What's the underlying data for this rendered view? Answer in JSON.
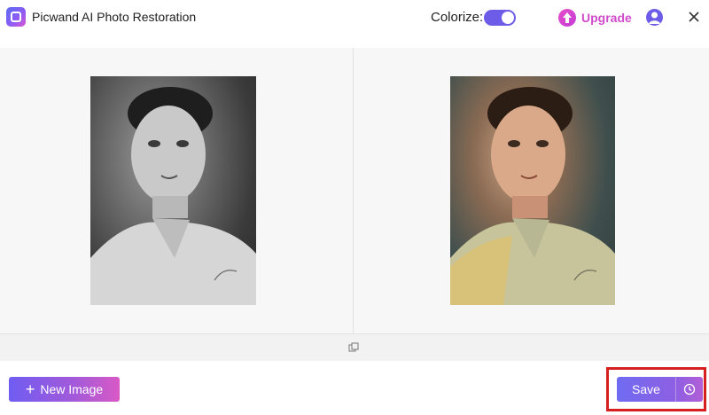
{
  "app": {
    "title": "Picwand AI Photo Restoration"
  },
  "header": {
    "colorize_label": "Colorize:",
    "colorize_enabled": true,
    "upgrade_label": "Upgrade"
  },
  "icons": {
    "logo": "picwand-logo-icon",
    "upgrade": "upgrade-arrow-icon",
    "account": "user-account-icon",
    "close": "close-icon",
    "compare": "compare-copy-icon",
    "add": "plus-icon",
    "history": "history-clock-icon"
  },
  "images": {
    "original": "original black-and-white portrait",
    "restored": "colorized restored portrait"
  },
  "footer": {
    "new_image_label": "New Image",
    "save_label": "Save"
  },
  "colors": {
    "accent": "#6c5ce7",
    "upgrade": "#d04ccc",
    "highlight": "#d61f1f"
  }
}
